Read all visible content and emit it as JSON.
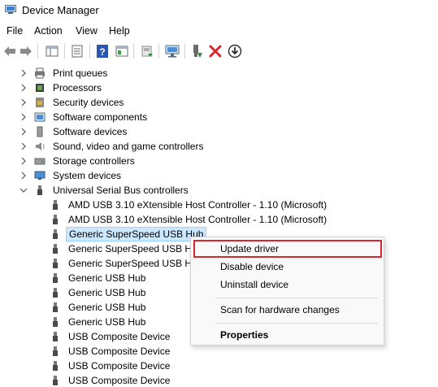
{
  "window": {
    "title": "Device Manager"
  },
  "menu": {
    "file": "File",
    "action": "Action",
    "view": "View",
    "help": "Help"
  },
  "toolbar": {
    "icons": [
      "back-arrow-icon",
      "forward-arrow-icon",
      "show-hide-tree-icon",
      "properties-icon",
      "help-icon",
      "action-view-icon",
      "update-driver-icon",
      "scan-hardware-icon",
      "enable-device-icon",
      "uninstall-device-icon",
      "download-driver-icon"
    ],
    "uninstall_color": "#d9262e",
    "enable_color": "#2e8b3a"
  },
  "tree": {
    "categories": [
      {
        "label": "Print queues",
        "icon": "printer-icon"
      },
      {
        "label": "Processors",
        "icon": "processor-icon"
      },
      {
        "label": "Security devices",
        "icon": "security-icon"
      },
      {
        "label": "Software components",
        "icon": "software-component-icon"
      },
      {
        "label": "Software devices",
        "icon": "software-device-icon"
      },
      {
        "label": "Sound, video and game controllers",
        "icon": "speaker-icon"
      },
      {
        "label": "Storage controllers",
        "icon": "storage-icon"
      },
      {
        "label": "System devices",
        "icon": "system-device-icon"
      },
      {
        "label": "Universal Serial Bus controllers",
        "icon": "usb-icon"
      }
    ],
    "usb_children": [
      "AMD USB 3.10 eXtensible Host Controller - 1.10 (Microsoft)",
      "AMD USB 3.10 eXtensible Host Controller - 1.10 (Microsoft)",
      "Generic SuperSpeed USB Hub",
      "Generic SuperSpeed USB Hub",
      "Generic SuperSpeed USB Hub",
      "Generic USB Hub",
      "Generic USB Hub",
      "Generic USB Hub",
      "Generic USB Hub",
      "USB Composite Device",
      "USB Composite Device",
      "USB Composite Device",
      "USB Composite Device"
    ],
    "selected_color": "#cce8ff"
  },
  "context_menu": {
    "update_driver": "Update driver",
    "disable_device": "Disable device",
    "uninstall_device": "Uninstall device",
    "scan": "Scan for hardware changes",
    "properties": "Properties",
    "highlight_color": "#d9262e"
  }
}
